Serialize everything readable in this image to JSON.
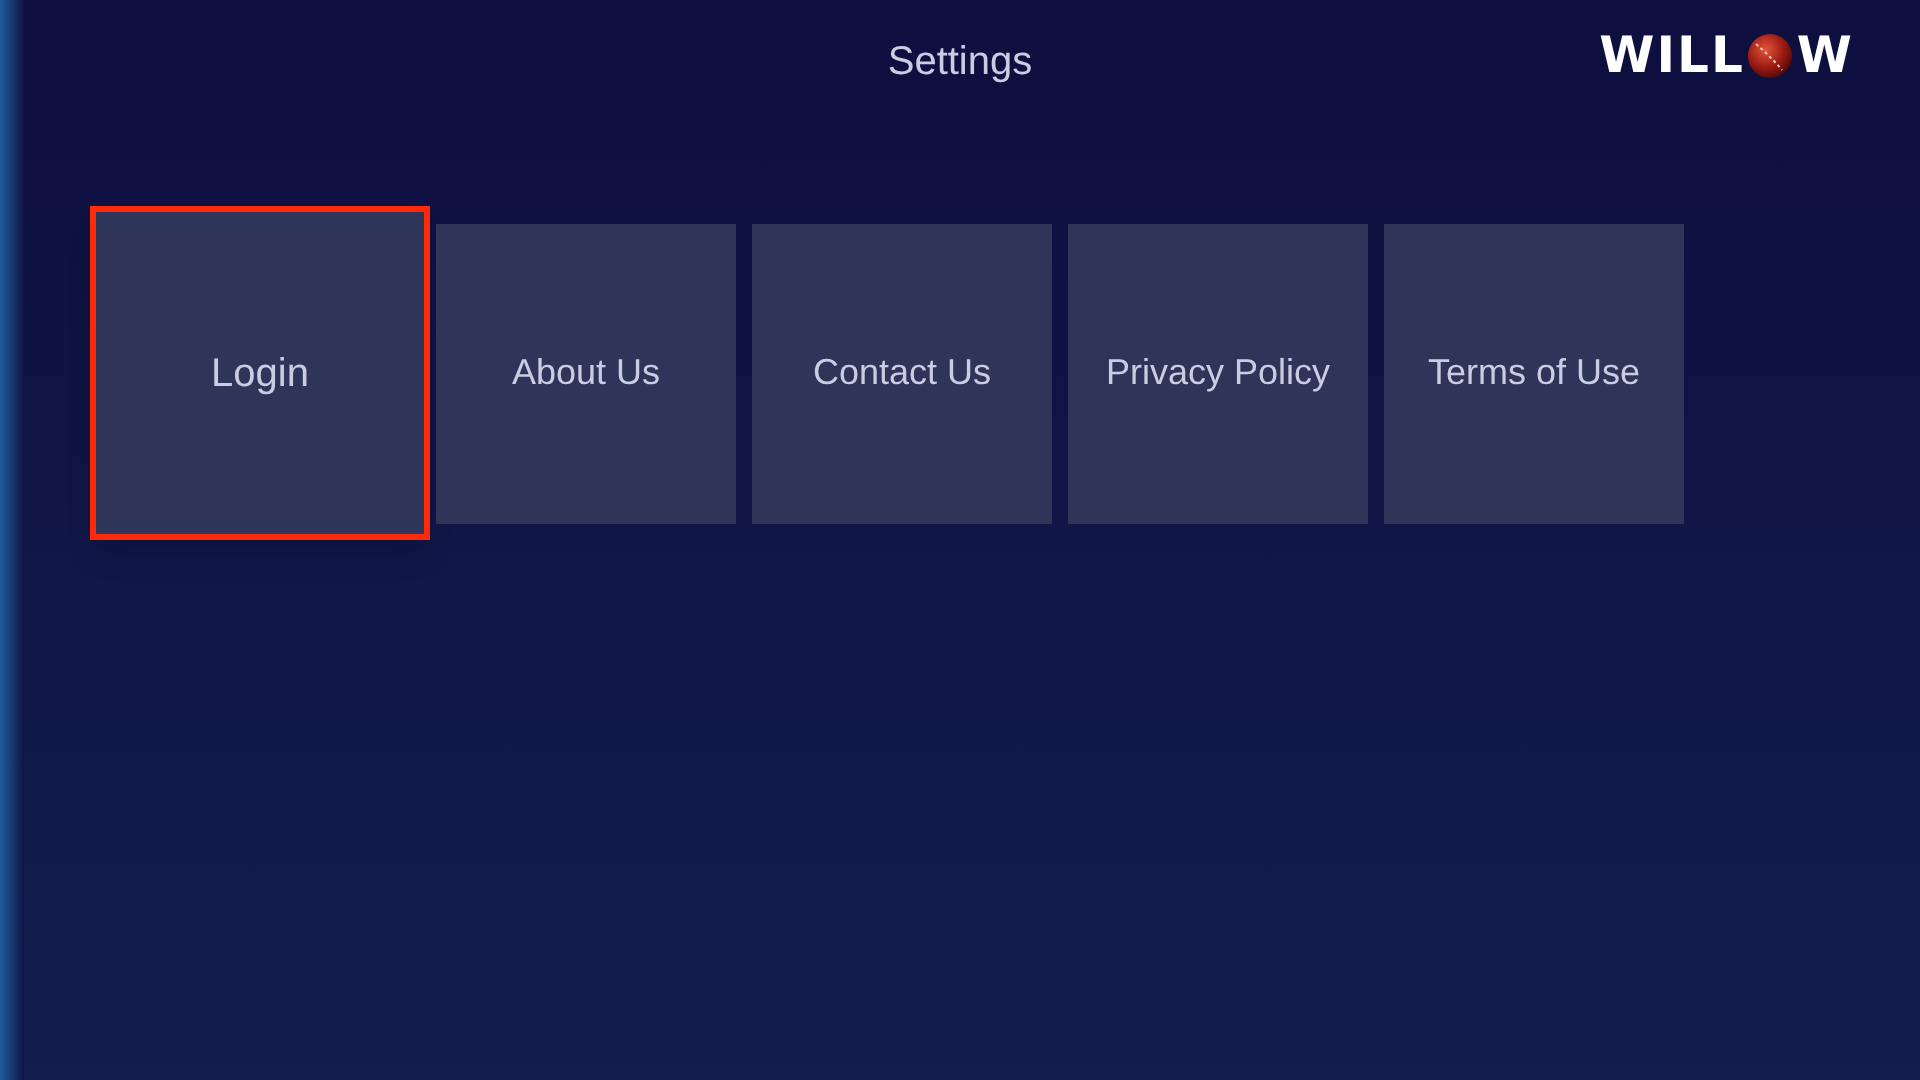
{
  "header": {
    "title": "Settings",
    "logo": {
      "before": "WILL",
      "after": "W"
    }
  },
  "tiles": [
    {
      "label": "Login",
      "selected": true
    },
    {
      "label": "About Us",
      "selected": false
    },
    {
      "label": "Contact Us",
      "selected": false
    },
    {
      "label": "Privacy Policy",
      "selected": false
    },
    {
      "label": "Terms of Use",
      "selected": false
    }
  ]
}
